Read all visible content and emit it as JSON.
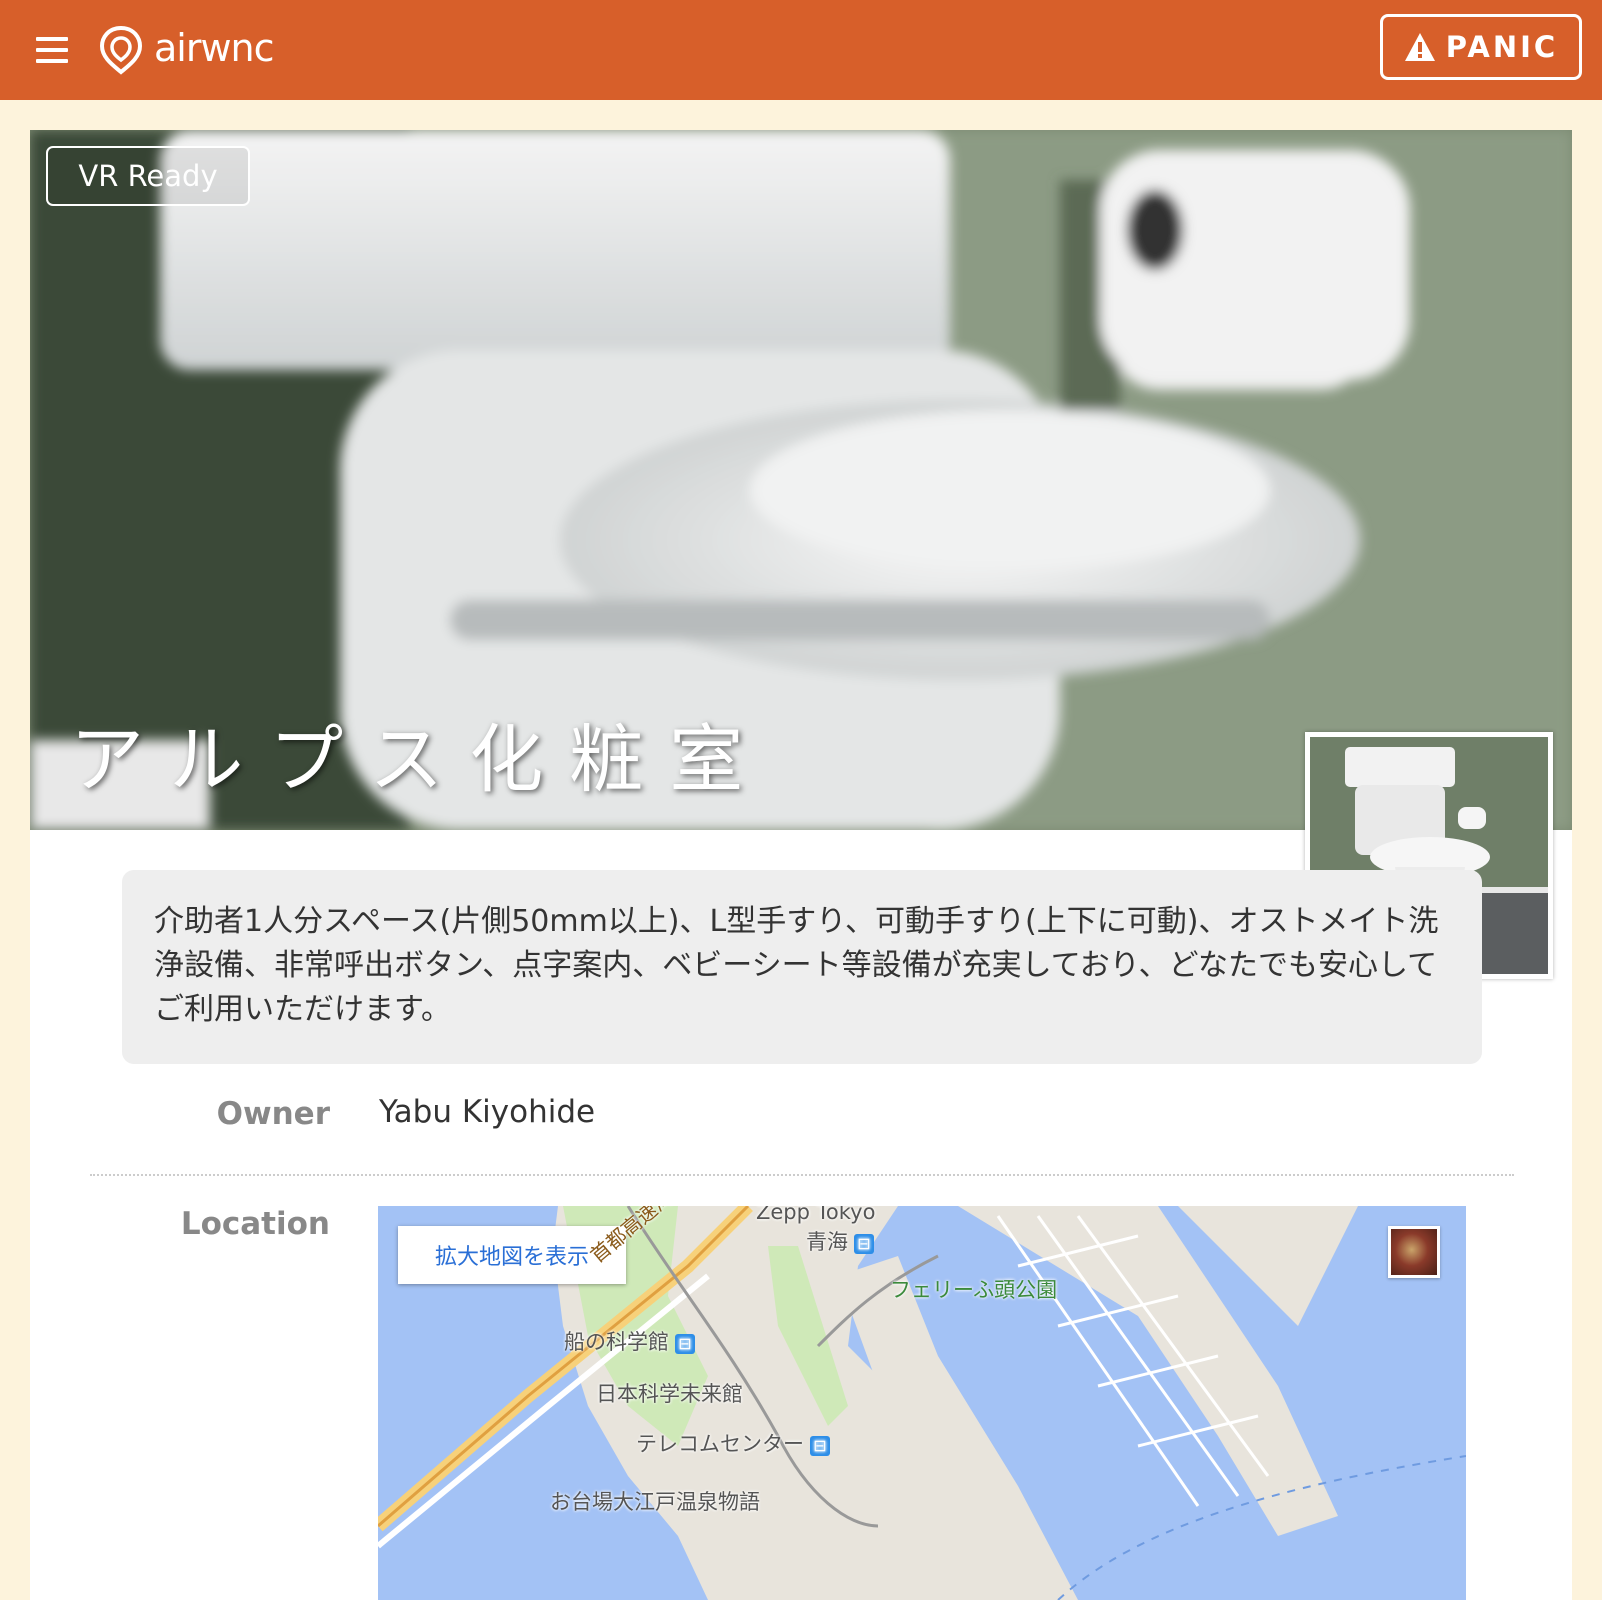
{
  "header": {
    "logo_text": "airwnc",
    "panic_label": "PANIC",
    "menu_icon": "hamburger-menu-icon",
    "panic_icon": "warning-triangle-icon",
    "brand_color": "#d75f2a"
  },
  "listing": {
    "badge": "VR Ready",
    "title": "アルプス化粧室",
    "description": "介助者1人分スペース(片側50mm以上)、L型手すり、可動手すり(上下に可動)、オストメイト洗浄設備、非常呼出ボタン、点字案内、ベビーシート等設備が充実しており、どなたでも安心してご利用いただけます。",
    "owner_label": "Owner",
    "owner_value": "Yabu Kiyohide",
    "location_label": "Location"
  },
  "map": {
    "open_larger_button": "拡大地図を表示",
    "labels": [
      {
        "text": "青海",
        "kind": "station"
      },
      {
        "text": "フェリーふ頭公園",
        "kind": "park"
      },
      {
        "text": "船の科学館",
        "kind": "station"
      },
      {
        "text": "日本科学未来館",
        "kind": "museum"
      },
      {
        "text": "テレコムセンター",
        "kind": "station"
      },
      {
        "text": "お台場大江戸温泉物語",
        "kind": "hotel"
      },
      {
        "text": "首都高速湾岸線",
        "kind": "road"
      },
      {
        "text": "Zepp Tokyo",
        "kind": "venue"
      }
    ]
  }
}
